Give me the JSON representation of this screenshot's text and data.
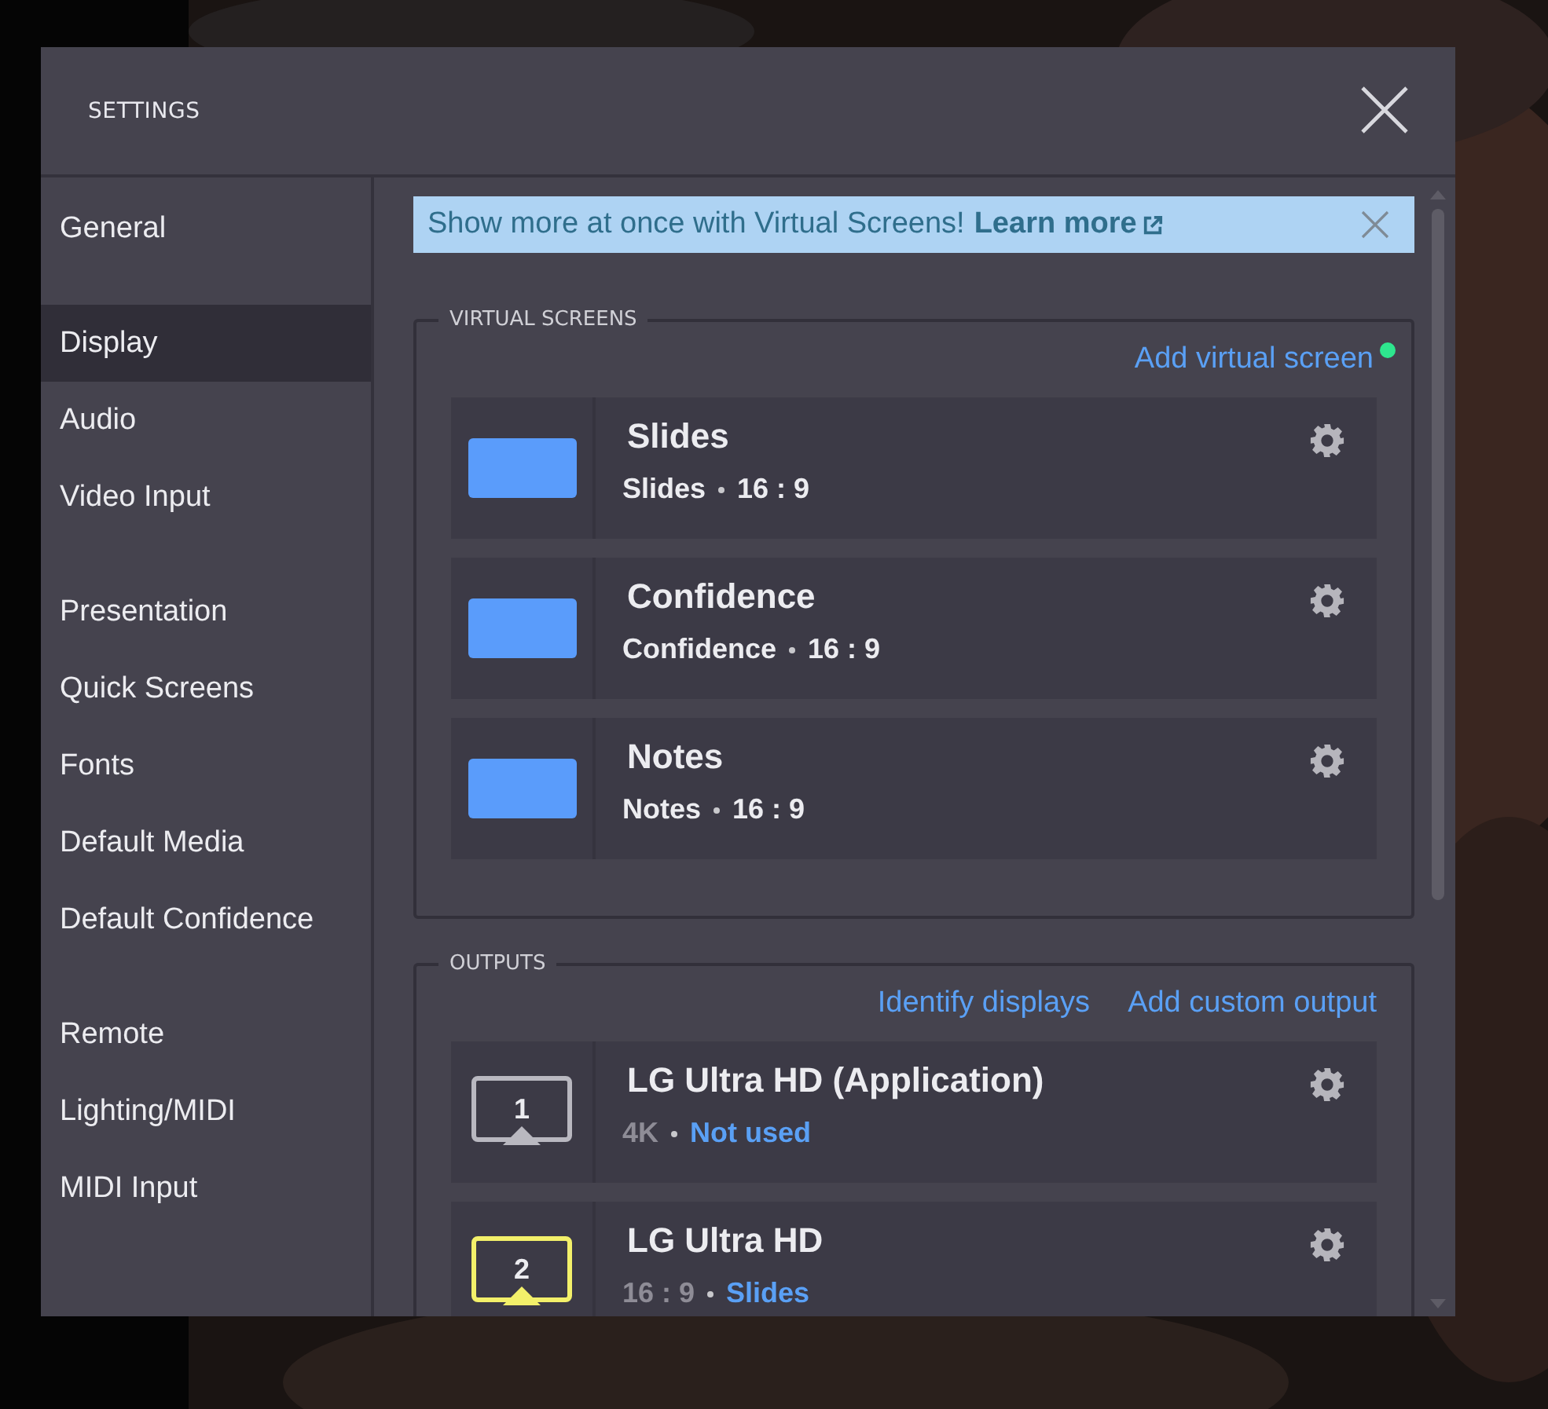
{
  "window": {
    "title": "SETTINGS"
  },
  "sidebar": {
    "groups": [
      [
        {
          "label": "General",
          "selected": false
        }
      ],
      [
        {
          "label": "Display",
          "selected": true
        },
        {
          "label": "Audio",
          "selected": false
        },
        {
          "label": "Video Input",
          "selected": false
        }
      ],
      [
        {
          "label": "Presentation",
          "selected": false
        },
        {
          "label": "Quick Screens",
          "selected": false
        },
        {
          "label": "Fonts",
          "selected": false
        },
        {
          "label": "Default Media",
          "selected": false
        },
        {
          "label": "Default Confidence",
          "selected": false
        }
      ],
      [
        {
          "label": "Remote",
          "selected": false
        },
        {
          "label": "Lighting/MIDI",
          "selected": false
        },
        {
          "label": "MIDI Input",
          "selected": false
        }
      ]
    ]
  },
  "banner": {
    "text": "Show more at once with Virtual Screens!",
    "link": "Learn more"
  },
  "virtual_screens": {
    "heading": "VIRTUAL SCREENS",
    "action": "Add virtual screen",
    "items": [
      {
        "name": "Slides",
        "type": "Slides",
        "ratio": "16 : 9"
      },
      {
        "name": "Confidence",
        "type": "Confidence",
        "ratio": "16 : 9"
      },
      {
        "name": "Notes",
        "type": "Notes",
        "ratio": "16 : 9"
      }
    ]
  },
  "outputs": {
    "heading": "OUTPUTS",
    "actions": [
      "Identify displays",
      "Add custom output"
    ],
    "items": [
      {
        "number": "1",
        "color": "#b9b8c0",
        "name": "LG Ultra HD (Application)",
        "spec": "4K",
        "assignment": "Not used"
      },
      {
        "number": "2",
        "color": "#f3f06a",
        "name": "LG Ultra HD",
        "spec": "16 : 9",
        "assignment": "Slides"
      }
    ]
  }
}
